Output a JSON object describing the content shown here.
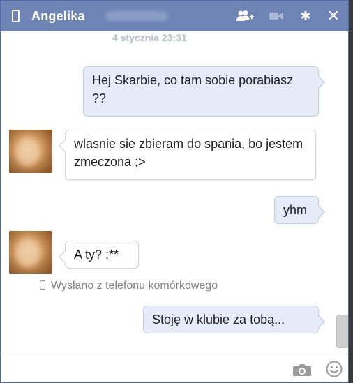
{
  "header": {
    "contact_name": "Angelika",
    "icons": {
      "phone": "phone-icon",
      "add_friend": "add-friend-icon",
      "video": "video-icon",
      "settings": "gear-icon",
      "close": "close-icon"
    }
  },
  "conversation": {
    "timestamp": "4 stycznia 23:31",
    "messages": [
      {
        "direction": "out",
        "text": "Hej Skarbie, co tam sobie porabiasz ??"
      },
      {
        "direction": "in",
        "text": "wlasnie sie zbieram do spania, bo jestem zmeczona ;>"
      },
      {
        "direction": "out",
        "text": "yhm"
      },
      {
        "direction": "in",
        "text": "A ty? ;**"
      },
      {
        "direction": "out",
        "text": "Stoję w klubie za tobą..."
      }
    ],
    "sent_from_mobile": "Wysłano z telefonu komórkowego"
  },
  "composer": {
    "input_value": "",
    "placeholder": "",
    "icons": {
      "camera": "camera-icon",
      "emoji": "smiley-icon"
    }
  },
  "colors": {
    "titlebar": "#6d84b4",
    "outgoing_bubble": "#e6ebf7",
    "incoming_bubble": "#ffffff"
  }
}
